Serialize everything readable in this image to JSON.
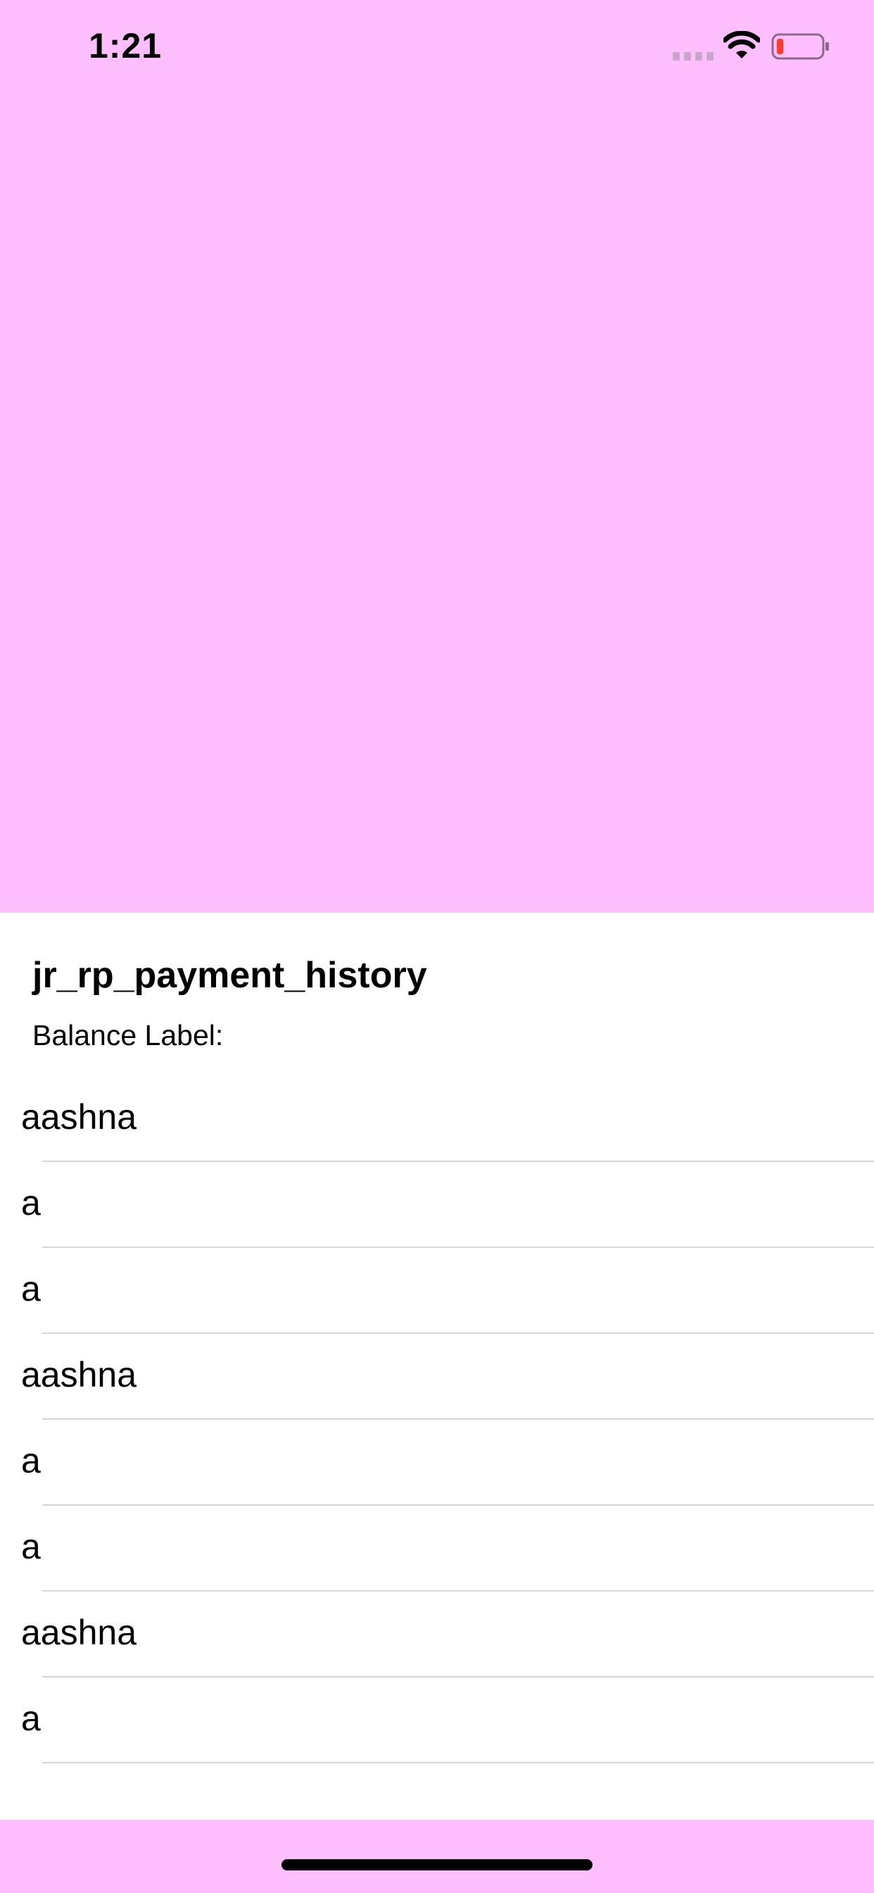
{
  "status_bar": {
    "time": "1:21",
    "icons": [
      "signal-icon",
      "wifi-icon",
      "battery-icon"
    ],
    "battery_level_fraction": 0.1,
    "battery_color": "#ff3b30"
  },
  "header": {
    "title": "jr_rp_payment_history",
    "balance_label": "Balance Label:"
  },
  "history": {
    "items": [
      {
        "label": "aashna"
      },
      {
        "label": "a"
      },
      {
        "label": "a"
      },
      {
        "label": "aashna"
      },
      {
        "label": "a"
      },
      {
        "label": "a"
      },
      {
        "label": "aashna"
      },
      {
        "label": "a"
      }
    ]
  },
  "colors": {
    "background": "#ffbfff",
    "content_background": "#ffffff",
    "divider": "#d6d6d6"
  }
}
